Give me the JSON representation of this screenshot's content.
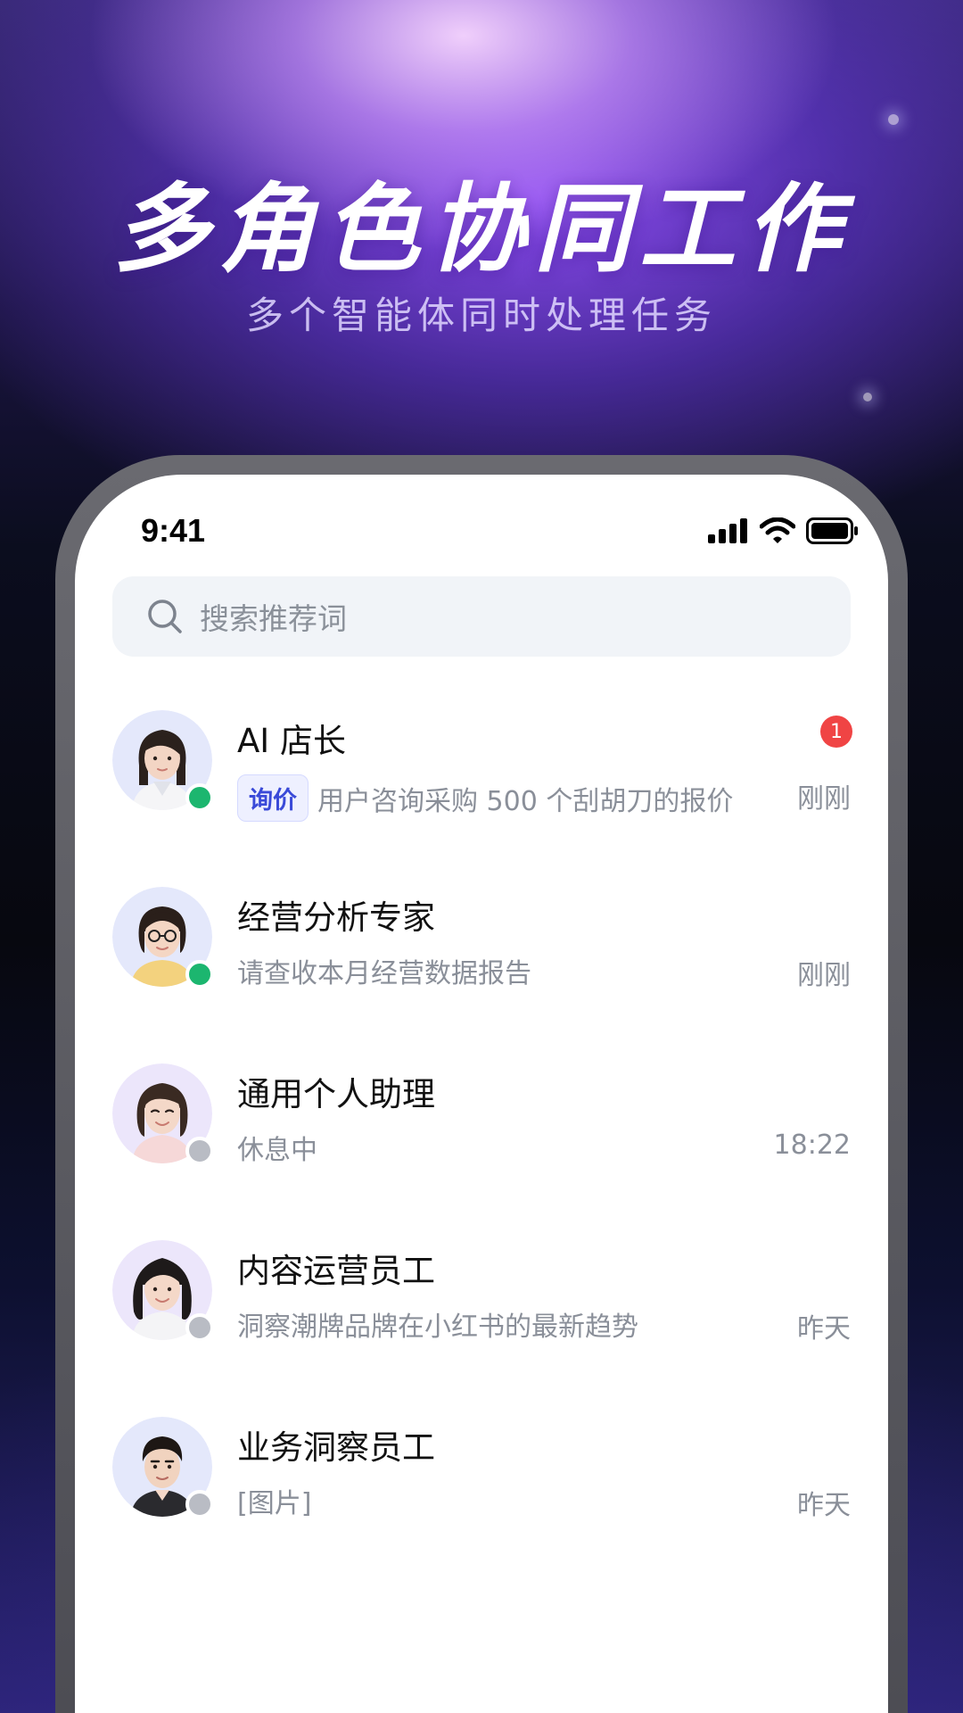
{
  "hero": {
    "title": "多角色协同工作",
    "subtitle": "多个智能体同时处理任务"
  },
  "status_bar": {
    "time": "9:41",
    "icons": [
      "signal-icon",
      "wifi-icon",
      "battery-icon"
    ]
  },
  "search": {
    "placeholder": "搜索推荐词"
  },
  "chats": [
    {
      "name": "AI 店长",
      "tag": "询价",
      "preview": "用户咨询采购 500 个刮胡刀的报价",
      "time": "刚刚",
      "badge": "1",
      "online": true
    },
    {
      "name": "经营分析专家",
      "preview": "请查收本月经营数据报告",
      "time": "刚刚",
      "online": true
    },
    {
      "name": "通用个人助理",
      "preview": "休息中",
      "time": "18:22",
      "online": false
    },
    {
      "name": "内容运营员工",
      "preview": "洞察潮牌品牌在小红书的最新趋势",
      "time": "昨天",
      "online": false
    },
    {
      "name": "业务洞察员工",
      "preview": "[图片]",
      "time": "昨天",
      "online": false
    }
  ],
  "colors": {
    "online": "#1cb66f",
    "offline": "#b9bcc4",
    "badge": "#f04444",
    "tag_text": "#3a4ad8"
  }
}
